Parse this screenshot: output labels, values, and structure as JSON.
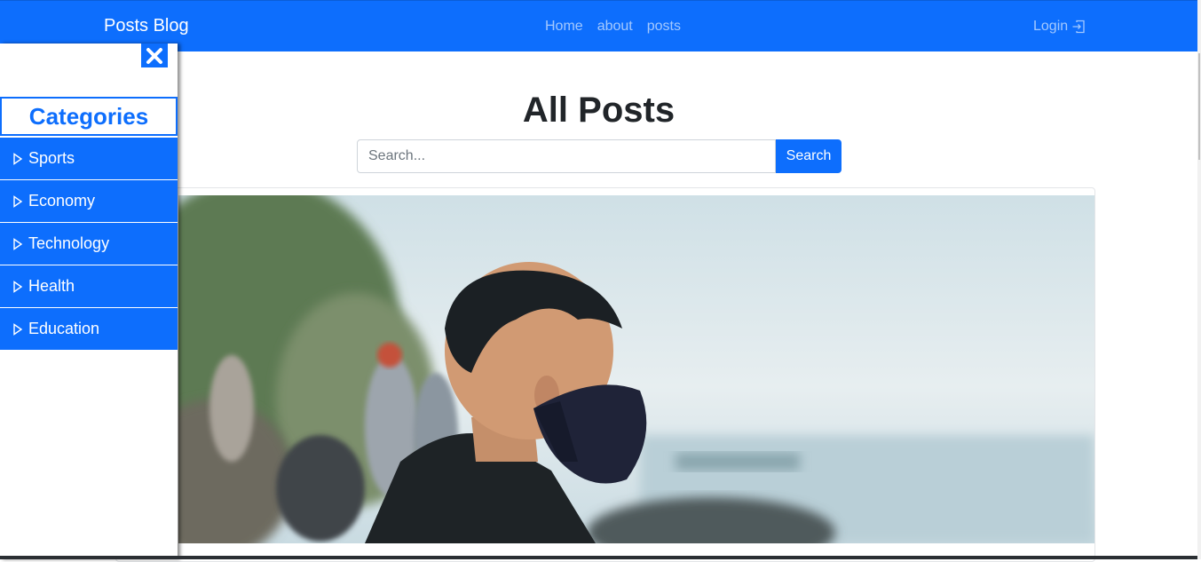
{
  "navbar": {
    "brand": "Posts Blog",
    "links": [
      "Home",
      "about",
      "posts"
    ],
    "login": "Login"
  },
  "main": {
    "title": "All Posts",
    "search": {
      "placeholder": "Search...",
      "button": "Search"
    }
  },
  "sidebar": {
    "title": "Categories",
    "items": [
      "Sports",
      "Economy",
      "Technology",
      "Health",
      "Education"
    ]
  },
  "colors": {
    "primary": "#0d6efd"
  }
}
